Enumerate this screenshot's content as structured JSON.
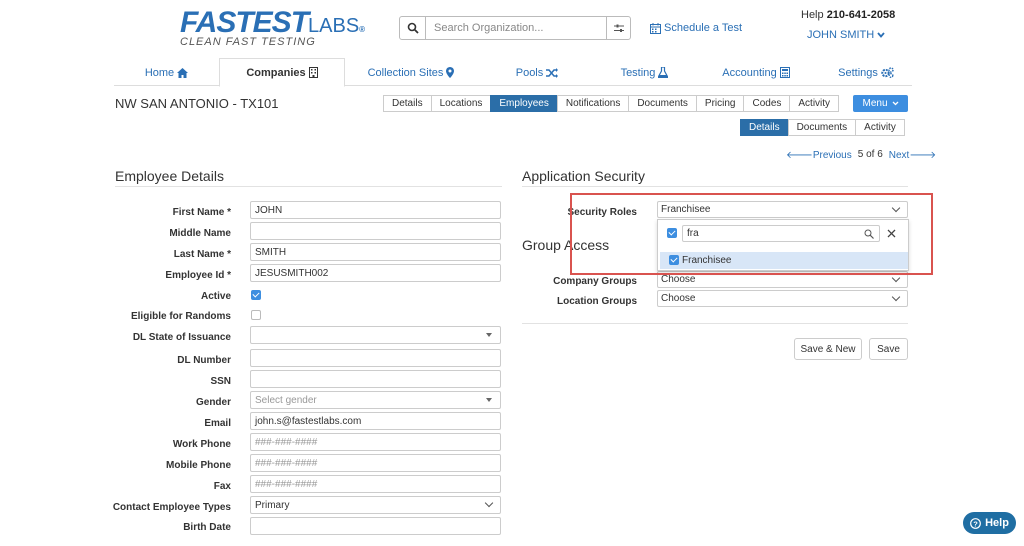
{
  "header": {
    "logo_main": "FASTEST",
    "logo_labs": "LABS",
    "logo_tagline": "CLEAN FAST TESTING",
    "search_placeholder": "Search Organization...",
    "schedule_label": "Schedule a Test",
    "help_label": "Help",
    "help_phone": "210-641-2058",
    "user_name": "JOHN SMITH"
  },
  "main_nav": [
    {
      "label": "Home",
      "icon": "home-icon"
    },
    {
      "label": "Companies",
      "icon": "building-icon",
      "active": true
    },
    {
      "label": "Collection Sites",
      "icon": "map-marker-icon"
    },
    {
      "label": "Pools",
      "icon": "shuffle-icon"
    },
    {
      "label": "Testing",
      "icon": "flask-icon"
    },
    {
      "label": "Accounting",
      "icon": "calculator-icon"
    },
    {
      "label": "Settings",
      "icon": "gears-icon"
    }
  ],
  "org_title": "NW SAN ANTONIO - TX101",
  "company_tabs": [
    "Details",
    "Locations",
    "Employees",
    "Notifications",
    "Documents",
    "Pricing",
    "Codes",
    "Activity"
  ],
  "company_tabs_active": "Employees",
  "menu_label": "Menu",
  "employee_tabs": [
    "Details",
    "Documents",
    "Activity"
  ],
  "employee_tabs_active": "Details",
  "pager": {
    "previous": "Previous",
    "position": "5 of 6",
    "next": "Next"
  },
  "employee_details": {
    "title": "Employee Details",
    "fields": {
      "first_name": {
        "label": "First Name *",
        "value": "JOHN"
      },
      "middle_name": {
        "label": "Middle Name",
        "value": ""
      },
      "last_name": {
        "label": "Last Name *",
        "value": "SMITH"
      },
      "employee_id": {
        "label": "Employee Id *",
        "value": "JESUSMITH002"
      },
      "active": {
        "label": "Active",
        "checked": true
      },
      "eligible": {
        "label": "Eligible for Randoms",
        "checked": false
      },
      "dl_state": {
        "label": "DL State of Issuance",
        "value": ""
      },
      "dl_number": {
        "label": "DL Number",
        "value": ""
      },
      "ssn": {
        "label": "SSN",
        "value": ""
      },
      "gender": {
        "label": "Gender",
        "placeholder": "Select gender"
      },
      "email": {
        "label": "Email",
        "value": "john.s@fastestlabs.com"
      },
      "work_phone": {
        "label": "Work Phone",
        "placeholder": "###-###-####"
      },
      "mobile_phone": {
        "label": "Mobile Phone",
        "placeholder": "###-###-####"
      },
      "fax": {
        "label": "Fax",
        "placeholder": "###-###-####"
      },
      "contact_types": {
        "label": "Contact Employee Types",
        "value": "Primary"
      },
      "birth_date": {
        "label": "Birth Date",
        "value": ""
      }
    }
  },
  "application_security": {
    "title": "Application Security",
    "security_roles_label": "Security Roles",
    "security_roles_value": "Franchisee",
    "dropdown_search": "fra",
    "dropdown_option": "Franchisee"
  },
  "group_access": {
    "title": "Group Access",
    "company_groups_label": "Company Groups",
    "company_groups_value": "Choose",
    "location_groups_label": "Location Groups",
    "location_groups_value": "Choose"
  },
  "buttons": {
    "save_new": "Save & New",
    "save": "Save"
  },
  "help_fab": "Help",
  "colors": {
    "brand_blue": "#2a6fb5",
    "active_tab": "#2b6ea8",
    "menu_button": "#3d8ee0",
    "highlight": "#d9534f"
  }
}
